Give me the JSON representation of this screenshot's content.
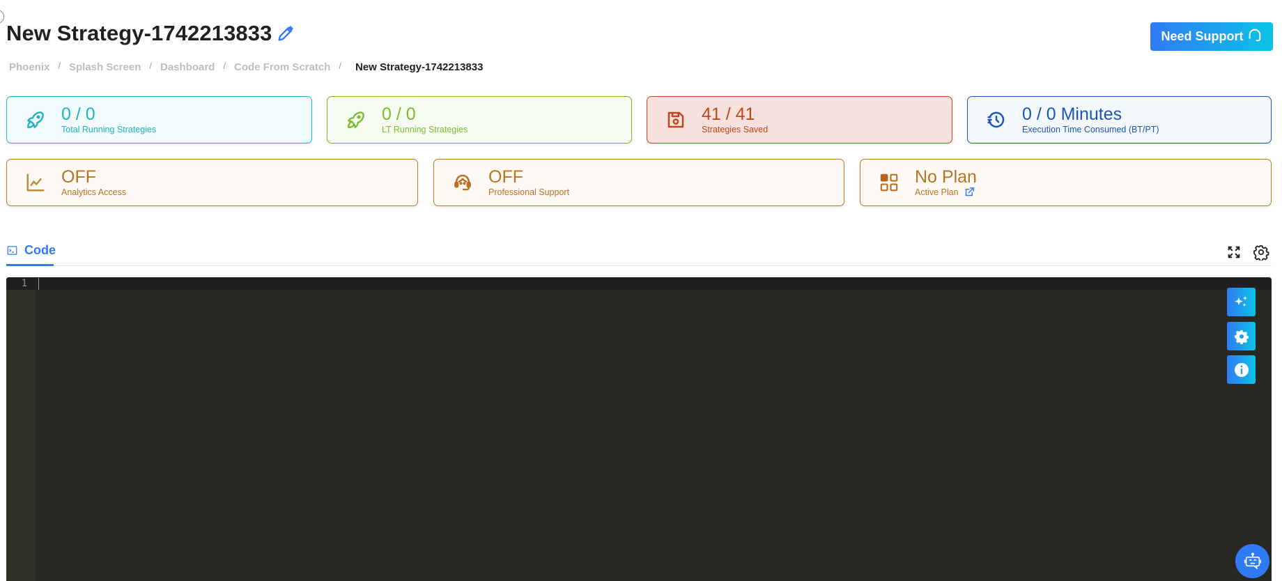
{
  "header": {
    "title": "New Strategy-1742213833",
    "support_button": "Need Support"
  },
  "breadcrumb": {
    "items": [
      "Phoenix",
      "Splash Screen",
      "Dashboard",
      "Code From Scratch"
    ],
    "separator": "/",
    "current": "New Strategy-1742213833"
  },
  "stats": {
    "total_running": {
      "value": "0 / 0",
      "label": "Total Running Strategies",
      "color": "#1fb3c0"
    },
    "lt_running": {
      "value": "0 / 0",
      "label": "LT Running Strategies",
      "color": "#7cbb2a"
    },
    "saved": {
      "value": "41 / 41",
      "label": "Strategies Saved",
      "color": "#c2461c"
    },
    "exec_time": {
      "value": "0 / 0 Minutes",
      "label": "Execution Time Consumed (BT/PT)",
      "color": "#1a56b8"
    },
    "analytics": {
      "value": "OFF",
      "label": "Analytics Access",
      "color": "#b77322"
    },
    "pro_support": {
      "value": "OFF",
      "label": "Professional Support",
      "color": "#b77322"
    },
    "plan": {
      "value": "No Plan",
      "label": "Active Plan",
      "color": "#b77322"
    }
  },
  "tabs": {
    "code": "Code"
  },
  "editor": {
    "line_numbers": [
      "1"
    ],
    "content": ""
  },
  "colors": {
    "accent": "#2f7bf5",
    "accent_gradient_end": "#0bc3e6",
    "editor_bg": "#272822"
  }
}
